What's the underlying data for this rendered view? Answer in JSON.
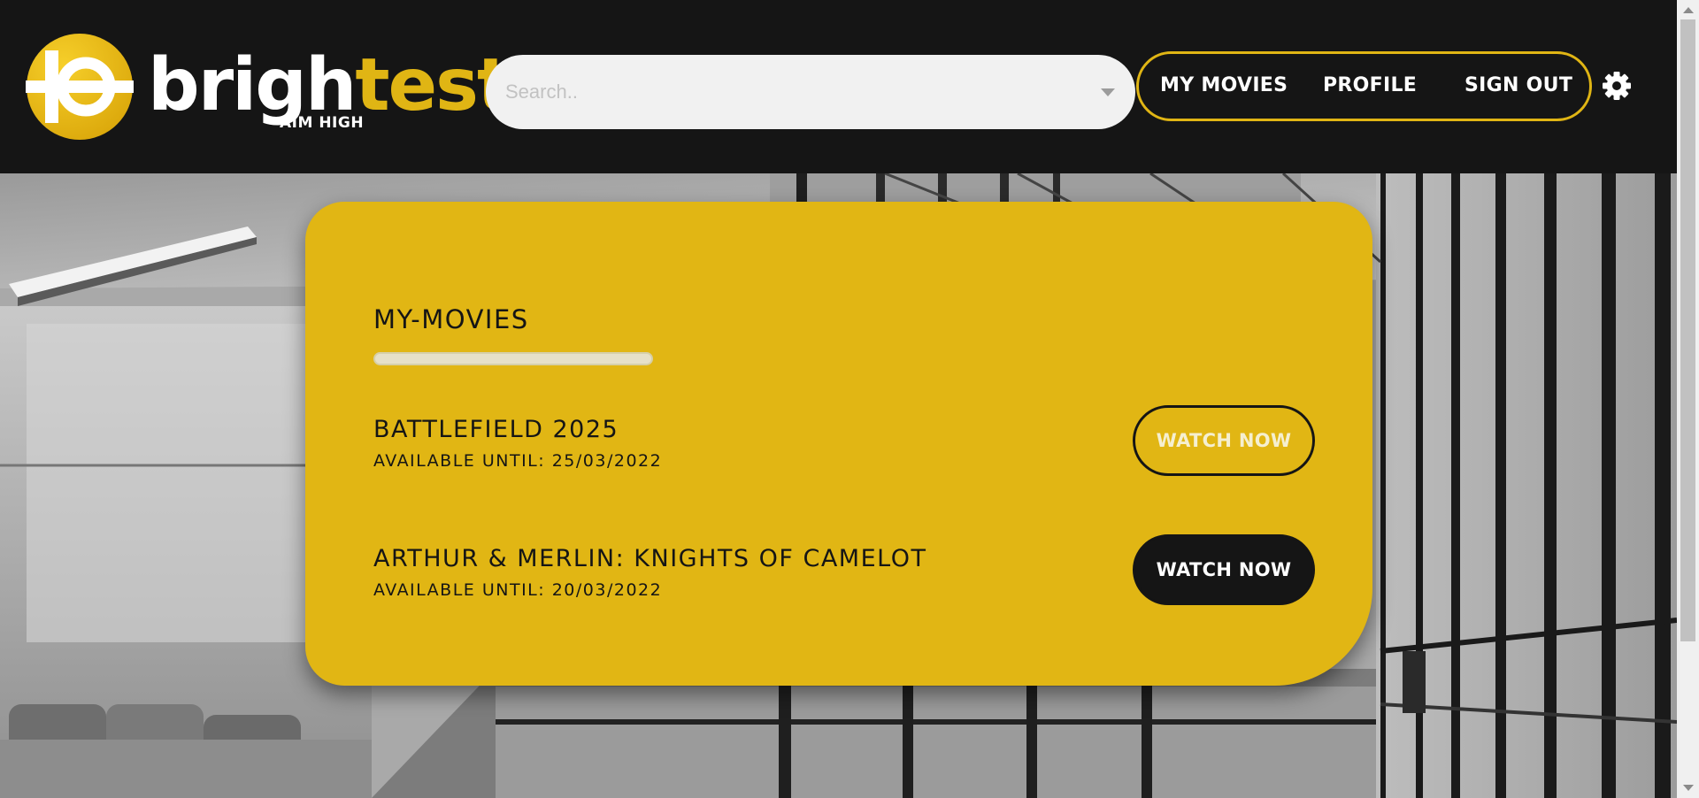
{
  "brand": {
    "word_light": "brigh",
    "word_accent": "test",
    "tagline": "AIM HIGH",
    "accent_color": "#e0b514"
  },
  "search": {
    "placeholder": "Search.."
  },
  "nav": {
    "items": [
      {
        "label": "MY MOVIES"
      },
      {
        "label": "PROFILE"
      },
      {
        "label": "SIGN OUT"
      }
    ],
    "settings_icon": "gear-icon"
  },
  "main": {
    "title": "MY-MOVIES",
    "movies": [
      {
        "title": "BATTLEFIELD 2025",
        "available": "AVAILABLE UNTIL: 25/03/2022",
        "action_label": "WATCH NOW",
        "action_style": "outline"
      },
      {
        "title": "ARTHUR & MERLIN: KNIGHTS OF CAMELOT",
        "available": "AVAILABLE UNTIL: 20/03/2022",
        "action_label": "WATCH NOW",
        "action_style": "solid"
      }
    ]
  },
  "colors": {
    "card": "#e1b614",
    "header": "#151515"
  }
}
